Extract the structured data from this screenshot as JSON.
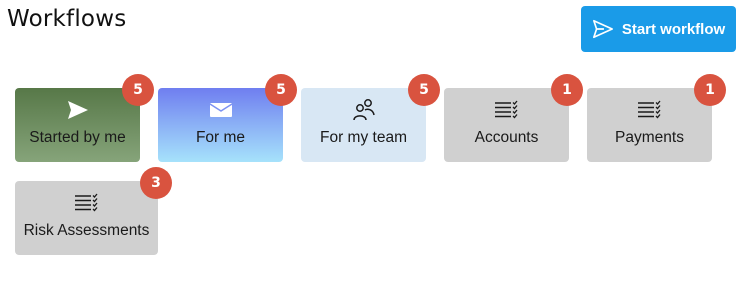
{
  "page": {
    "title": "Workflows"
  },
  "start_button": {
    "label": "Start workflow",
    "icon": "send-icon",
    "color": "#1a9be8"
  },
  "tiles": [
    {
      "label": "Started by me",
      "count": "5",
      "icon": "send-icon"
    },
    {
      "label": "For me",
      "count": "5",
      "icon": "envelope-icon"
    },
    {
      "label": "For my team",
      "count": "5",
      "icon": "team-icon"
    },
    {
      "label": "Accounts",
      "count": "1",
      "icon": "task-list-icon"
    },
    {
      "label": "Payments",
      "count": "1",
      "icon": "task-list-icon"
    },
    {
      "label": "Risk Assessments",
      "count": "3",
      "icon": "task-list-icon"
    }
  ],
  "colors": {
    "badge": "#d9533f",
    "tile_default": "#d0d0d0",
    "tile_team": "#d8e7f4"
  }
}
